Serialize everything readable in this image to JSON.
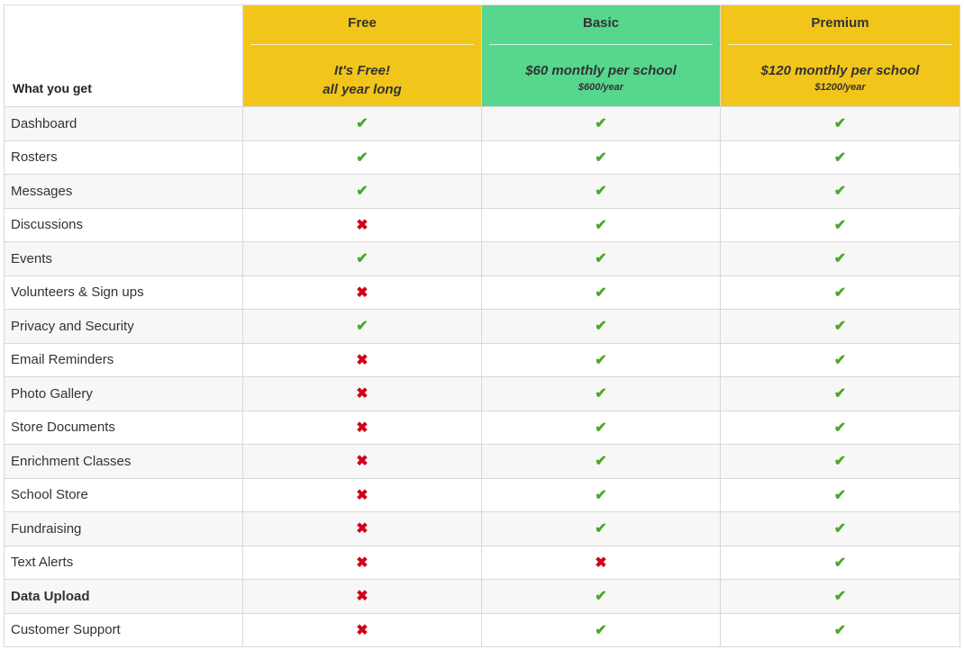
{
  "header": {
    "feature_label": "What you get",
    "plans": [
      {
        "name": "Free",
        "price_line1": "It's Free!",
        "price_line2": "all year long",
        "sub": "",
        "color": "#f2c51b"
      },
      {
        "name": "Basic",
        "price_line1": "$60 monthly per school",
        "price_line2": "",
        "sub": "$600/year",
        "color": "#57d68d"
      },
      {
        "name": "Premium",
        "price_line1": "$120 monthly per school",
        "price_line2": "",
        "sub": "$1200/year",
        "color": "#f2c51b"
      }
    ]
  },
  "icons": {
    "yes": "check-icon",
    "no": "cross-icon"
  },
  "symbols": {
    "yes": "✔",
    "no": "✖"
  },
  "colors": {
    "yes": "#4aa82a",
    "no": "#d0021b"
  },
  "features": [
    {
      "label": "Dashboard",
      "bold": false,
      "free": true,
      "basic": true,
      "premium": true
    },
    {
      "label": "Rosters",
      "bold": false,
      "free": true,
      "basic": true,
      "premium": true
    },
    {
      "label": "Messages",
      "bold": false,
      "free": true,
      "basic": true,
      "premium": true
    },
    {
      "label": "Discussions",
      "bold": false,
      "free": false,
      "basic": true,
      "premium": true
    },
    {
      "label": "Events",
      "bold": false,
      "free": true,
      "basic": true,
      "premium": true
    },
    {
      "label": "Volunteers & Sign ups",
      "bold": false,
      "free": false,
      "basic": true,
      "premium": true
    },
    {
      "label": "Privacy and Security",
      "bold": false,
      "free": true,
      "basic": true,
      "premium": true
    },
    {
      "label": "Email Reminders",
      "bold": false,
      "free": false,
      "basic": true,
      "premium": true
    },
    {
      "label": "Photo Gallery",
      "bold": false,
      "free": false,
      "basic": true,
      "premium": true
    },
    {
      "label": "Store Documents",
      "bold": false,
      "free": false,
      "basic": true,
      "premium": true
    },
    {
      "label": "Enrichment Classes",
      "bold": false,
      "free": false,
      "basic": true,
      "premium": true
    },
    {
      "label": "School Store",
      "bold": false,
      "free": false,
      "basic": true,
      "premium": true
    },
    {
      "label": "Fundraising",
      "bold": false,
      "free": false,
      "basic": true,
      "premium": true
    },
    {
      "label": "Text Alerts",
      "bold": false,
      "free": false,
      "basic": false,
      "premium": true
    },
    {
      "label": "Data Upload",
      "bold": true,
      "free": false,
      "basic": true,
      "premium": true
    },
    {
      "label": "Customer Support",
      "bold": false,
      "free": false,
      "basic": true,
      "premium": true
    }
  ]
}
